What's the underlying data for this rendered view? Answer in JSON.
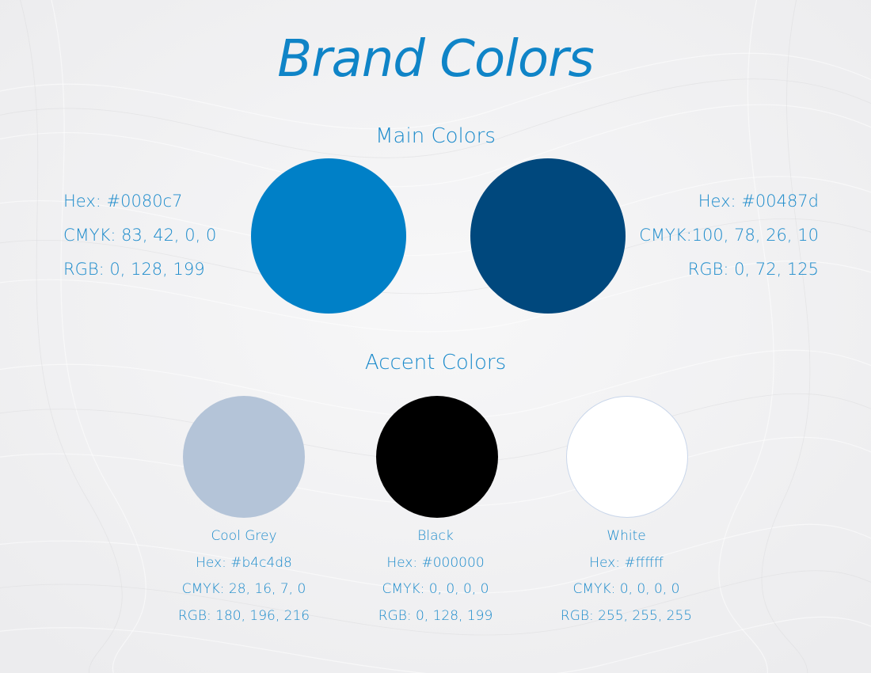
{
  "title": "Brand Colors",
  "main": {
    "heading": "Main Colors",
    "colors": [
      {
        "swatch": "#0080c7",
        "hex_line": "Hex: #0080c7",
        "cmyk_line": "CMYK: 83, 42, 0, 0",
        "rgb_line": "RGB: 0, 128, 199"
      },
      {
        "swatch": "#00487d",
        "hex_line": "Hex: #00487d",
        "cmyk_line": "CMYK:100, 78, 26, 10",
        "rgb_line": "RGB: 0, 72, 125"
      }
    ]
  },
  "accent": {
    "heading": "Accent Colors",
    "colors": [
      {
        "swatch": "#b4c4d8",
        "name": "Cool Grey",
        "hex_line": "Hex: #b4c4d8",
        "cmyk_line": "CMYK: 28, 16, 7, 0",
        "rgb_line": "RGB: 180, 196, 216"
      },
      {
        "swatch": "#000000",
        "name": "Black",
        "hex_line": "Hex: #000000",
        "cmyk_line": "CMYK: 0, 0, 0, 0",
        "rgb_line": "RGB: 0, 128, 199"
      },
      {
        "swatch": "#ffffff",
        "name": "White",
        "hex_line": "Hex: #ffffff",
        "cmyk_line": "CMYK: 0, 0, 0, 0",
        "rgb_line": "RGB: 255, 255, 255"
      }
    ]
  },
  "colors": {
    "title": "#0f84c7",
    "text": "#1a8acb",
    "background": "#f2f2f3"
  }
}
